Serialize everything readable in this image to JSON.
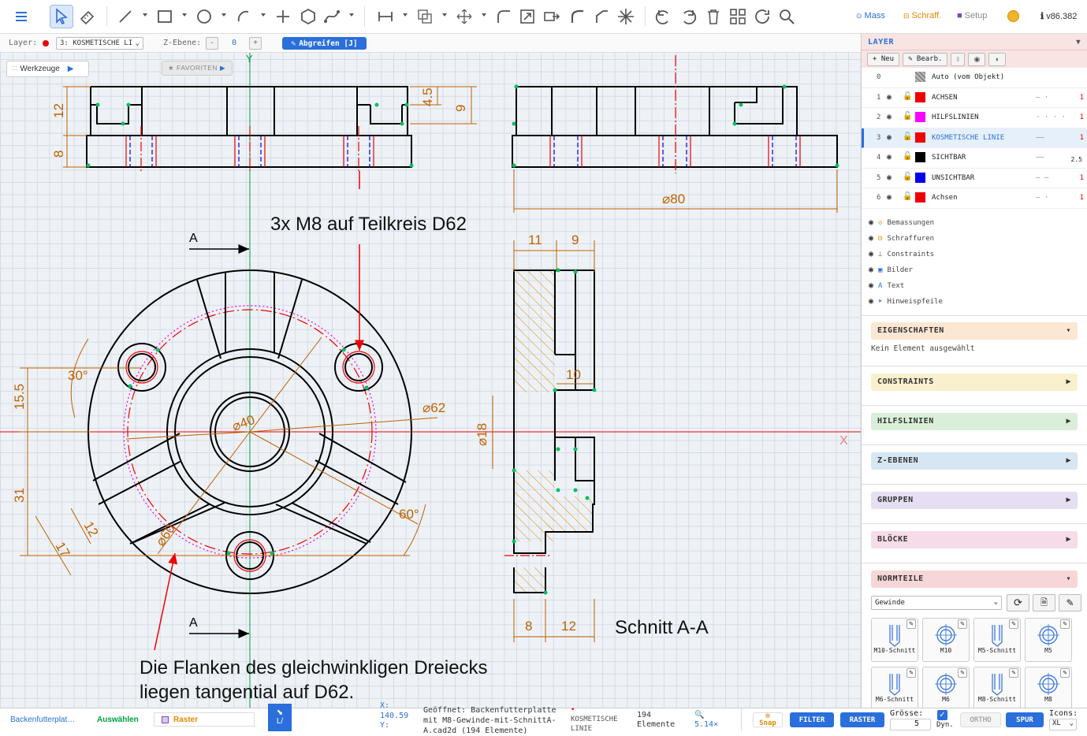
{
  "toolbar": {
    "mass": "Mass",
    "schraff": "Schraff.",
    "setup": "Setup",
    "version": "v86.382"
  },
  "secbar": {
    "layer_label": "Layer:",
    "layer_value": "3: KOSMETISCHE LI",
    "zebene_label": "Z-Ebene:",
    "zebene_minus": "-",
    "zebene_value": "0",
    "zebene_plus": "+",
    "abgreifen": "Abgreifen [J]"
  },
  "canvas": {
    "werkzeuge": "Werkzeuge",
    "favoriten": "★ FAVORITEN",
    "axis_y": "Y",
    "axis_x": "X",
    "dims": {
      "d12": "12",
      "d8": "8",
      "d45": "4.5",
      "d9": "9",
      "d80": "⌀80",
      "d11": "11",
      "d9b": "9",
      "d10": "10",
      "d18": "⌀18",
      "d8b": "8",
      "d12b": "12",
      "d30": "30°",
      "d155": "15.5",
      "d31": "31",
      "d17": "17",
      "d12c": "12",
      "d60a": "⌀60",
      "d40": "⌀40",
      "d62": "⌀62",
      "d60deg": "60°"
    },
    "text_m8": "3x M8 auf Teilkreis D62",
    "section_a1": "A",
    "section_a2": "A",
    "schnitt": "Schnitt A-A",
    "note_line1": "Die Flanken des gleichwinkligen Dreiecks",
    "note_line2": "liegen tangential auf D62."
  },
  "panel": {
    "layer_header": "LAYER",
    "neu": "+ Neu",
    "bearb": "✎ Bearb.",
    "layers": [
      {
        "num": "0",
        "name": "Auto (vom Objekt)",
        "color": "#999999",
        "line": "",
        "width": ""
      },
      {
        "num": "1",
        "name": "ACHSEN",
        "color": "#ee0000",
        "line": "— ·",
        "width": "1"
      },
      {
        "num": "2",
        "name": "HILFSLINIEN",
        "color": "#ff00ff",
        "line": "· · · ·",
        "width": "1"
      },
      {
        "num": "3",
        "name": "KOSMETISCHE LINIE",
        "color": "#ee0000",
        "line": "——",
        "width": "1"
      },
      {
        "num": "4",
        "name": "SICHTBAR",
        "color": "#000000",
        "line": "——",
        "width": "2.5"
      },
      {
        "num": "5",
        "name": "UNSICHTBAR",
        "color": "#0000ee",
        "line": "— —",
        "width": "1"
      },
      {
        "num": "6",
        "name": "Achsen",
        "color": "#ee0000",
        "line": "— ·",
        "width": "1"
      }
    ],
    "vis": [
      {
        "icon": "◇",
        "label": "Bemassungen"
      },
      {
        "icon": "⊟",
        "label": "Schraffuren"
      },
      {
        "icon": "⊥",
        "label": "Constraints"
      },
      {
        "icon": "▣",
        "label": "Bilder"
      },
      {
        "icon": "A",
        "label": "Text"
      },
      {
        "icon": "➤",
        "label": "Hinweispfeile"
      }
    ],
    "eigenschaften": "EIGENSCHAFTEN",
    "kein_element": "Kein Element ausgewählt",
    "constraints": "CONSTRAINTS",
    "hilfslinien": "HILFSLINIEN",
    "zebenen": "Z-EBENEN",
    "gruppen": "GRUPPEN",
    "bloecke": "BLÖCKE",
    "normteile": "NORMTEILE",
    "gewinde": "Gewinde",
    "normparts": [
      "M10-Schnitt",
      "M10",
      "M5-Schnitt",
      "M5",
      "M6-Schnitt",
      "M6",
      "M8-Schnitt",
      "M8"
    ]
  },
  "status": {
    "file": "Backenfutterplat…",
    "auswaehlen": "Auswählen",
    "raster": "Raster",
    "x_label": "X:",
    "x_value": "140.59",
    "y_label": "Y:",
    "opened_line1": "Geöffnet: Backenfutterplatte",
    "opened_line2": "mit M8-Gewinde-mit-SchnittA-",
    "opened_line3": "A.cad2d (194 Elemente)",
    "layer_line1": "KOSMETISCHE",
    "layer_line2": "LINIE",
    "count": "194",
    "elemente": "Elemente",
    "zoom": "5.14×",
    "snap": "Snap",
    "filter": "FILTER",
    "raster_btn": "RASTER",
    "groesse": "Grösse:",
    "groesse_val": "5",
    "dyn": "Dyn.",
    "ortho": "ORTHO",
    "spur": "SPUR",
    "icons": "Icons:",
    "icons_val": "XL"
  }
}
